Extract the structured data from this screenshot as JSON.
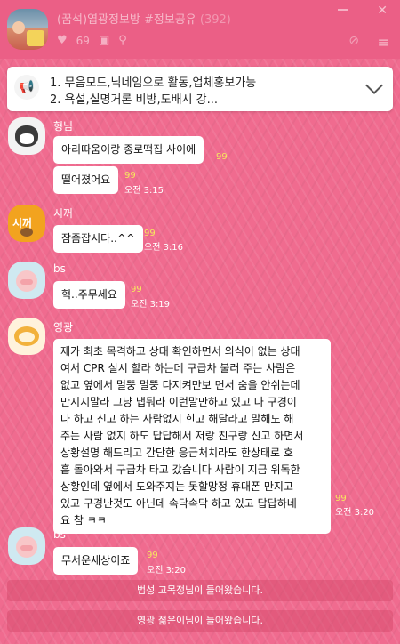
{
  "header": {
    "title": "(꿈석)엽광정보방 #정보공유",
    "member_count": "(392)",
    "likes": "69",
    "icons": [
      "heart-icon",
      "box-icon",
      "person-icon",
      "mute-icon",
      "menu-icon",
      "minimize-icon",
      "close-icon"
    ]
  },
  "notice": {
    "line1": "1. 무음모드,닉네임으로 활동,업체홍보가능",
    "line2": "2. 욕설,실명거론 비방,도배시 강..."
  },
  "messages": [
    {
      "sender": "형님",
      "bubbles": [
        {
          "text": "아리따움이랑 종로떡집 사이에",
          "unread": "99",
          "time": ""
        },
        {
          "text": "떨어졌어요",
          "unread": "99",
          "time": "오전 3:15"
        }
      ]
    },
    {
      "sender": "시꺼",
      "avatar_text": "시꺼",
      "bubbles": [
        {
          "text": "잠좀잡시다..^^",
          "unread": "99",
          "time": "오전 3:16"
        }
      ]
    },
    {
      "sender": "bs",
      "bubbles": [
        {
          "text": "헉..주무세요",
          "unread": "99",
          "time": "오전 3:19"
        }
      ]
    },
    {
      "sender": "영광",
      "bubbles": [
        {
          "lines": [
            "제가 최초 목격하고 상태 확인하면서 의식이 없는 상태",
            "여서 CPR 실시 할라 하는데 구급차 불러 주는 사람은",
            "없고 옆에서 멀뚱 멀뚱 다지켜만보 면서 숨을 안쉬는데",
            "만지지말라 그냥 냅둬라 이런말만하고 있고 다 구경이",
            "나 하고  신고 하는 사람없지 힌고 해달라고 말해도 해",
            "주는 사람 없지 하도 답답해서 저랑 친구랑 신고 하면서",
            " 상황설명 해드리고 간단한 응급처치라도 한상태로 호",
            "흡 돌아와서 구급차 타고 갔습니다 사람이 지금 위독한",
            "상황인데 옆에서 도와주지는 못할망정  휴대폰 만지고",
            "있고 구경난것도 아닌데 속닥속닥 하고 있고 답답하네",
            "요 참 ㅋㅋ"
          ],
          "unread": "99",
          "time": "오전 3:20"
        }
      ]
    },
    {
      "sender": "bs",
      "bubbles": [
        {
          "text": "무서운세상이죠",
          "unread": "99",
          "time": "오전 3:20"
        }
      ]
    }
  ],
  "system": [
    "법성 고목정님이 들어왔습니다.",
    "영광 젊은이님이 들어왔습니다."
  ],
  "colors": {
    "background": "#f06b8f",
    "unread": "#f6e85d",
    "bubble": "#ffffff"
  }
}
